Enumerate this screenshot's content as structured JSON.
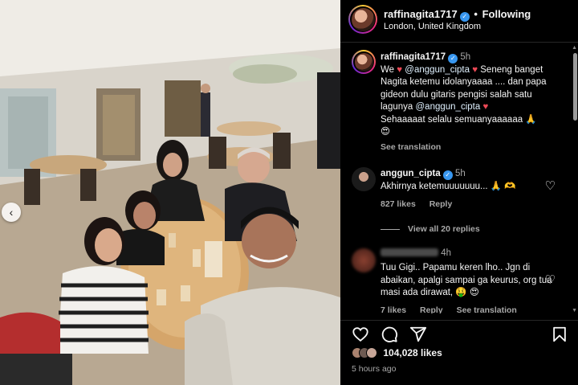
{
  "header": {
    "username": "raffinagita1717",
    "follow_status": "Following",
    "location": "London, United Kingdom"
  },
  "caption": {
    "username": "raffinagita1717",
    "time": "5h",
    "text_part1": "We",
    "mention1": "@anggun_cipta",
    "text_part2": "Seneng banget Nagita ketemu idolanyaaaa .... dan papa gideon dulu gitaris pengisi salah satu lagunya",
    "mention2": "@anggun_cipta",
    "text_part3": "Sehaaaaat selalu semuanyaaaaaa",
    "see_translation": "See translation"
  },
  "comments": [
    {
      "username": "anggun_cipta",
      "time": "5h",
      "text": "Akhirnya ketemuuuuuuu...",
      "likes": "827 likes",
      "reply": "Reply",
      "view_replies": "View all 20 replies"
    },
    {
      "time": "4h",
      "text": "Tuu Gigi.. Papamu keren lho.. Jgn di abaikan, apalgi sampai ga keurus, org tua masi ada dirawat,",
      "likes": "7 likes",
      "reply": "Reply",
      "see_translation": "See translation"
    }
  ],
  "footer": {
    "like_count": "104,028 likes",
    "posted_ago": "5 hours ago"
  },
  "icons": {
    "like": "heart-icon",
    "comment": "comment-icon",
    "share": "share-icon",
    "save": "bookmark-icon",
    "carousel": "chevron-left-icon"
  },
  "colors": {
    "background": "#000000",
    "verified": "#3897f0",
    "heart": "#ed4956",
    "muted_text": "#a8a8a8"
  }
}
